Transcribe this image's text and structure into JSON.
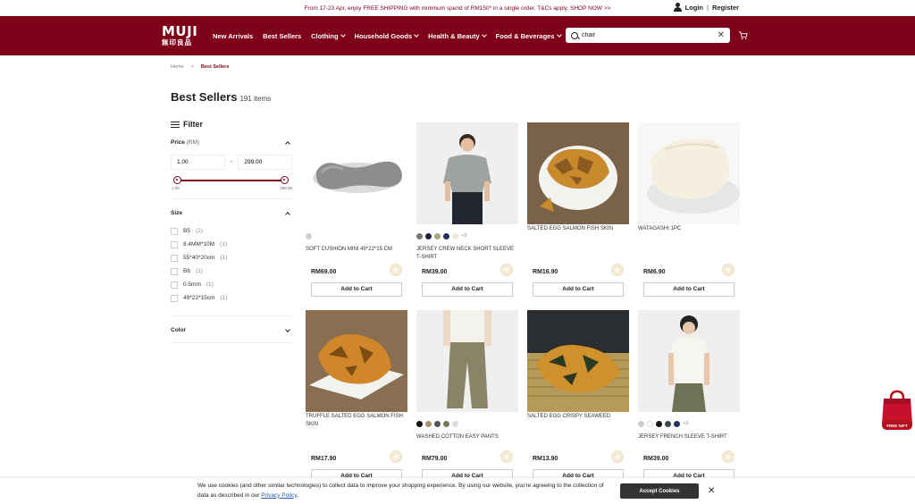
{
  "promo": {
    "text": "From 17-23 Apr, enjoy FREE SHIPPING with minimum spend of RM150* in a single order. T&Cs apply. SHOP NOW >>",
    "login": "Login",
    "separator": "|",
    "register": "Register"
  },
  "logo": {
    "line1": "MUJI",
    "line2": "無印良品"
  },
  "nav": {
    "items": [
      {
        "label": "New Arrivals",
        "dropdown": false
      },
      {
        "label": "Best Sellers",
        "dropdown": false
      },
      {
        "label": "Clothing",
        "dropdown": true
      },
      {
        "label": "Household Goods",
        "dropdown": true
      },
      {
        "label": "Health & Beauty",
        "dropdown": true
      },
      {
        "label": "Food & Beverages",
        "dropdown": true
      }
    ]
  },
  "search": {
    "value": "chair",
    "clear": "✕"
  },
  "breadcrumb": {
    "home": "Home",
    "separator": ">",
    "current": "Best Sellers"
  },
  "page": {
    "title": "Best Sellers",
    "count": "191 items"
  },
  "filter": {
    "title": "Filter",
    "price": {
      "label": "Price",
      "unit": "(RM)",
      "min": "1.00",
      "max": "299.00",
      "dash": "-",
      "min_label": "1.00",
      "max_label": "299.00"
    },
    "size": {
      "label": "Size",
      "options": [
        {
          "label": "B5",
          "count": "(2)"
        },
        {
          "label": "8.4MM*10M",
          "count": "(1)"
        },
        {
          "label": "55*40*20cm",
          "count": "(1)"
        },
        {
          "label": "B6",
          "count": "(1)"
        },
        {
          "label": "0.5mm",
          "count": "(1)"
        },
        {
          "label": "49*22*15cm",
          "count": "(1)"
        }
      ]
    },
    "color": {
      "label": "Color"
    }
  },
  "products": [
    {
      "name": "SOFT CUSHION MINI 49*22*15 CM",
      "price": "RM69.00",
      "cart": "Add to Cart",
      "swatches": [
        "#cfcfcf"
      ],
      "more": ""
    },
    {
      "name": "JERSEY CREW NECK SHORT SLEEVE T-SHIRT",
      "price": "RM39.00",
      "cart": "Add to Cart",
      "swatches": [
        "#777777",
        "#1d2346",
        "#a9a583",
        "#26305a",
        "#ece8d6"
      ],
      "more": "+3"
    },
    {
      "name": "SALTED EGG SALMON FISH SKIN",
      "price": "RM16.90",
      "cart": "Add to Cart",
      "swatches": [],
      "more": ""
    },
    {
      "name": "WATAGASHI 1PC",
      "price": "RM6.90",
      "cart": "Add to Cart",
      "swatches": [],
      "more": ""
    },
    {
      "name": "TRUFFLE SALTED EGG SALMON FISH SKIN",
      "price": "RM17.90",
      "cart": "Add to Cart",
      "swatches": [],
      "more": ""
    },
    {
      "name": "WASHED COTTON EASY PANTS",
      "price": "RM79.00",
      "cart": "Add to Cart",
      "swatches": [
        "#111111",
        "#a8946a",
        "#555555",
        "#6f7a5a",
        "#dddddd"
      ],
      "more": ""
    },
    {
      "name": "SALTED EGG CRISPY SEAWEED",
      "price": "RM13.90",
      "cart": "Add to Cart",
      "swatches": [],
      "more": ""
    },
    {
      "name": "JERSEY FRENCH SLEEVE T-SHIRT",
      "price": "RM39.00",
      "cart": "Add to Cart",
      "swatches": [
        "#cccccc",
        "#ffffff",
        "#111111",
        "#3a4a4a",
        "#26305a"
      ],
      "more": "+3"
    }
  ],
  "cookie": {
    "text": "We use cookies (and other similar technologies) to collect data to improve your shopping experience. By using our website, you're agreeing to the collection of data as described in our ",
    "link": "Privacy Policy",
    "end": ".",
    "accept": "Accept Cookies",
    "close": "✕"
  },
  "gift": {
    "line1": "FREE GIFT"
  },
  "colors": {
    "brand": "#7f0019",
    "heart_bg": "#f5ecd8"
  }
}
